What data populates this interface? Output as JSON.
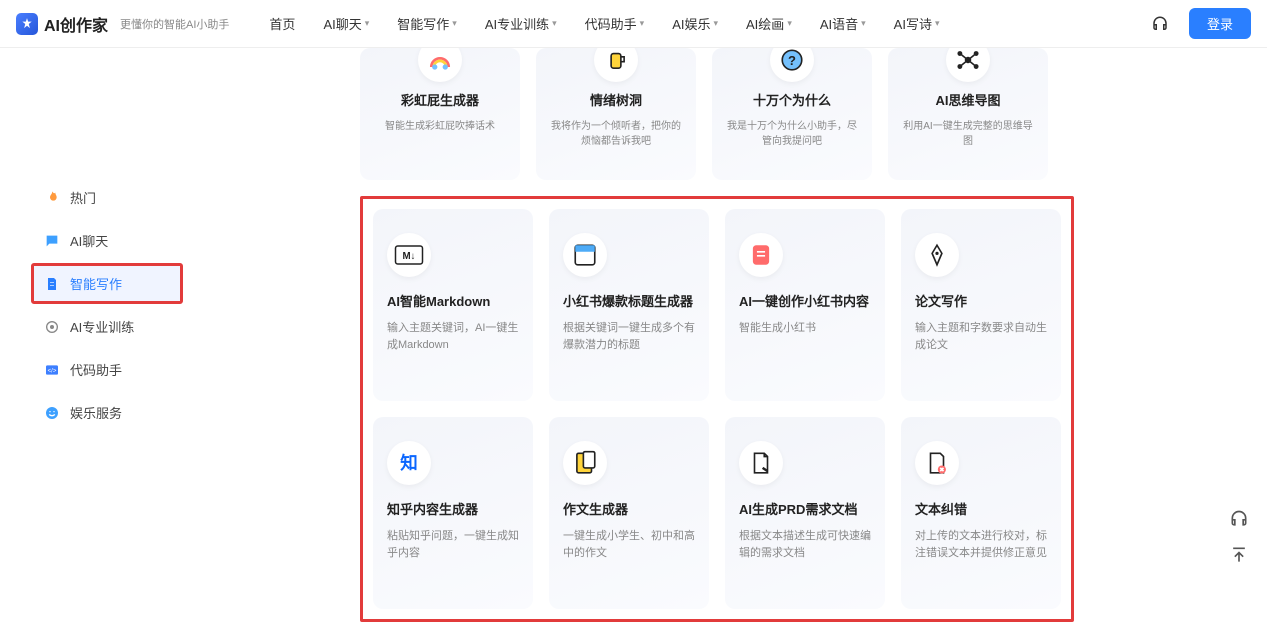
{
  "header": {
    "logo_text": "AI创作家",
    "subtitle": "更懂你的智能AI小助手",
    "nav": [
      "首页",
      "AI聊天",
      "智能写作",
      "AI专业训练",
      "代码助手",
      "AI娱乐",
      "AI绘画",
      "AI语音",
      "AI写诗"
    ],
    "nav_has_chev": [
      false,
      true,
      true,
      true,
      true,
      true,
      true,
      true,
      true
    ],
    "login": "登录"
  },
  "sidebar": {
    "items": [
      {
        "label": "热门",
        "icon": "fire"
      },
      {
        "label": "AI聊天",
        "icon": "chat"
      },
      {
        "label": "智能写作",
        "icon": "doc",
        "active": true
      },
      {
        "label": "AI专业训练",
        "icon": "brain"
      },
      {
        "label": "代码助手",
        "icon": "code"
      },
      {
        "label": "娱乐服务",
        "icon": "smile"
      }
    ]
  },
  "top_row": [
    {
      "title": "彩虹屁生成器",
      "desc": "智能生成彩虹屁吹捧话术",
      "icon": "rainbow"
    },
    {
      "title": "情绪树洞",
      "desc": "我将作为一个倾听者，把你的烦恼都告诉我吧",
      "icon": "cup"
    },
    {
      "title": "十万个为什么",
      "desc": "我是十万个为什么小助手，尽管向我提问吧",
      "icon": "question"
    },
    {
      "title": "AI思维导图",
      "desc": "利用AI一键生成完整的思维导图",
      "icon": "mindmap"
    }
  ],
  "grid": [
    [
      {
        "title": "AI智能Markdown",
        "desc": "输入主题关键词，AI一键生成Markdown",
        "icon": "md"
      },
      {
        "title": "小红书爆款标题生成器",
        "desc": "根据关键词一键生成多个有爆款潜力的标题",
        "icon": "window"
      },
      {
        "title": "AI一键创作小红书内容",
        "desc": "智能生成小红书",
        "icon": "note"
      },
      {
        "title": "论文写作",
        "desc": "输入主题和字数要求自动生成论文",
        "icon": "pen"
      }
    ],
    [
      {
        "title": "知乎内容生成器",
        "desc": "粘贴知乎问题，一键生成知乎内容",
        "icon": "zhi"
      },
      {
        "title": "作文生成器",
        "desc": "一键生成小学生、初中和高中的作文",
        "icon": "essay"
      },
      {
        "title": "AI生成PRD需求文档",
        "desc": "根据文本描述生成可快速编辑的需求文档",
        "icon": "prd"
      },
      {
        "title": "文本纠错",
        "desc": "对上传的文本进行校对，标注错误文本并提供修正意见",
        "icon": "error"
      }
    ]
  ]
}
